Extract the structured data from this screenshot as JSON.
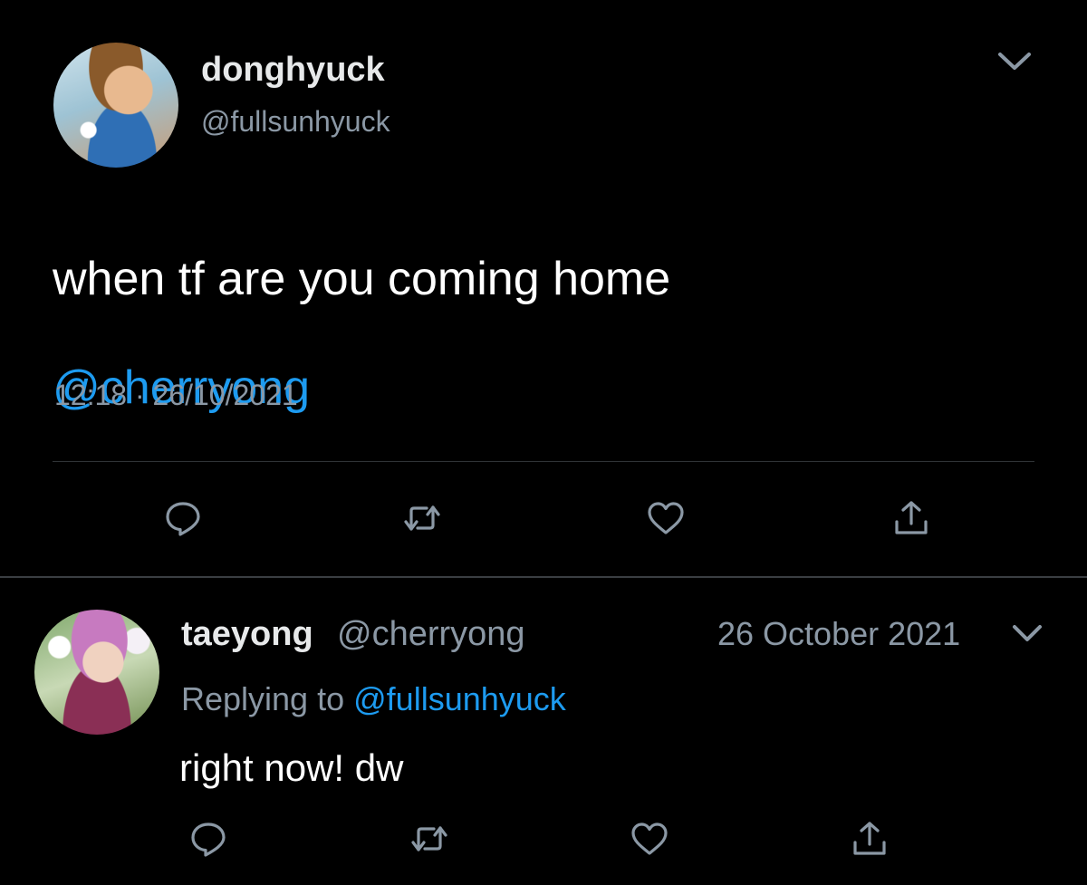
{
  "colors": {
    "background": "#000000",
    "text": "#ffffff",
    "secondary_text": "#8b98a5",
    "link": "#1d9bf0",
    "divider": "#2f3336"
  },
  "tweet": {
    "author": {
      "display_name": "donghyuck",
      "handle": "@fullsunhyuck",
      "avatar_icon": "profile-photo"
    },
    "text_line1": "when tf are you coming home",
    "mention": "@cherryong",
    "time": "12:18",
    "separator": "·",
    "date": "26/10/2021",
    "menu_icon": "chevron-down-icon",
    "actions": [
      {
        "icon": "reply-icon"
      },
      {
        "icon": "retweet-icon"
      },
      {
        "icon": "like-icon"
      },
      {
        "icon": "share-icon"
      }
    ]
  },
  "reply": {
    "author": {
      "display_name": "taeyong",
      "handle": "@cherryong",
      "avatar_icon": "profile-photo"
    },
    "date": "26 October 2021",
    "replying_label": "Replying to",
    "replying_to": "@fullsunhyuck",
    "text": "right now! dw",
    "menu_icon": "chevron-down-icon",
    "actions": [
      {
        "icon": "reply-icon"
      },
      {
        "icon": "retweet-icon"
      },
      {
        "icon": "like-icon"
      },
      {
        "icon": "share-icon"
      }
    ]
  }
}
